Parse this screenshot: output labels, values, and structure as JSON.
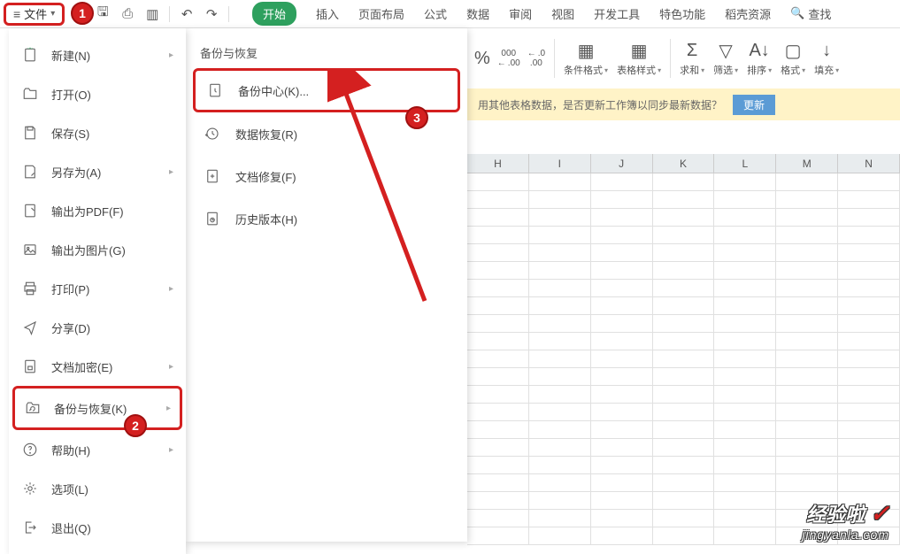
{
  "topbar": {
    "file_label": "文件"
  },
  "tabs": {
    "start": "开始",
    "insert": "插入",
    "page_layout": "页面布局",
    "formula": "公式",
    "data": "数据",
    "review": "审阅",
    "view": "视图",
    "dev": "开发工具",
    "special": "特色功能",
    "resources": "稻壳资源",
    "find": "查找"
  },
  "ribbon": {
    "percent": "%",
    "dec_inc": "000",
    "dec_inc2": ".00",
    "dec_dec": ".0",
    "dec_dec2": ".00",
    "cond_fmt": "条件格式",
    "table_style": "表格样式",
    "sum": "求和",
    "filter": "筛选",
    "sort": "排序",
    "format": "格式",
    "fill": "填充"
  },
  "notif": {
    "text": "用其他表格数据，是否更新工作簿以同步最新数据？",
    "update": "更新"
  },
  "file_menu": {
    "items": [
      {
        "label": "新建(N)",
        "has_sub": true
      },
      {
        "label": "打开(O)",
        "has_sub": false
      },
      {
        "label": "保存(S)",
        "has_sub": false
      },
      {
        "label": "另存为(A)",
        "has_sub": true
      },
      {
        "label": "输出为PDF(F)",
        "has_sub": false
      },
      {
        "label": "输出为图片(G)",
        "has_sub": false
      },
      {
        "label": "打印(P)",
        "has_sub": true
      },
      {
        "label": "分享(D)",
        "has_sub": false
      },
      {
        "label": "文档加密(E)",
        "has_sub": true
      },
      {
        "label": "备份与恢复(K)",
        "has_sub": true
      },
      {
        "label": "帮助(H)",
        "has_sub": true
      },
      {
        "label": "选项(L)",
        "has_sub": false
      },
      {
        "label": "退出(Q)",
        "has_sub": false
      }
    ]
  },
  "sub_menu": {
    "title": "备份与恢复",
    "items": [
      {
        "label": "备份中心(K)..."
      },
      {
        "label": "数据恢复(R)"
      },
      {
        "label": "文档修复(F)"
      },
      {
        "label": "历史版本(H)"
      }
    ]
  },
  "badges": {
    "b1": "1",
    "b2": "2",
    "b3": "3"
  },
  "columns": [
    "H",
    "I",
    "J",
    "K",
    "L",
    "M",
    "N"
  ],
  "watermark": {
    "top": "经验啦",
    "bottom": "jingyanla.com"
  }
}
